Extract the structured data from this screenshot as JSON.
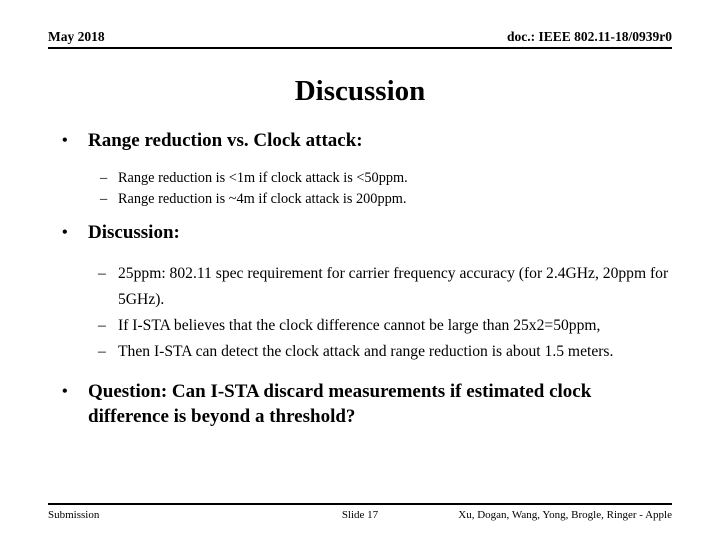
{
  "header": {
    "date": "May 2018",
    "doc": "doc.: IEEE 802.11-18/0939r0"
  },
  "title": "Discussion",
  "content": {
    "bullet1": {
      "marker": "•",
      "text": "Range reduction vs.  Clock attack:",
      "sub": [
        {
          "marker": "–",
          "text": "Range reduction is <1m if clock attack is <50ppm."
        },
        {
          "marker": "–",
          "text": "Range reduction is ~4m if clock attack is 200ppm."
        }
      ]
    },
    "bullet2": {
      "marker": "•",
      "text": "Discussion:",
      "sub": [
        {
          "marker": "–",
          "text": "25ppm:  802.11 spec requirement for carrier frequency accuracy (for 2.4GHz,  20ppm for 5GHz)."
        },
        {
          "marker": "–",
          "text": "If I-STA believes that the clock difference cannot be large than 25x2=50ppm,"
        },
        {
          "marker": "–",
          "text": "Then I-STA can detect the clock attack and range reduction is about 1.5 meters."
        }
      ]
    },
    "bullet3": {
      "marker": "•",
      "text": "Question:  Can I-STA discard measurements if estimated clock difference is beyond a threshold?"
    }
  },
  "footer": {
    "left": "Submission",
    "center": "Slide 17",
    "right": "Xu, Dogan, Wang, Yong, Brogle, Ringer - Apple"
  },
  "colors": {
    "text": "#000000",
    "background": "#ffffff",
    "rule": "#000000"
  }
}
